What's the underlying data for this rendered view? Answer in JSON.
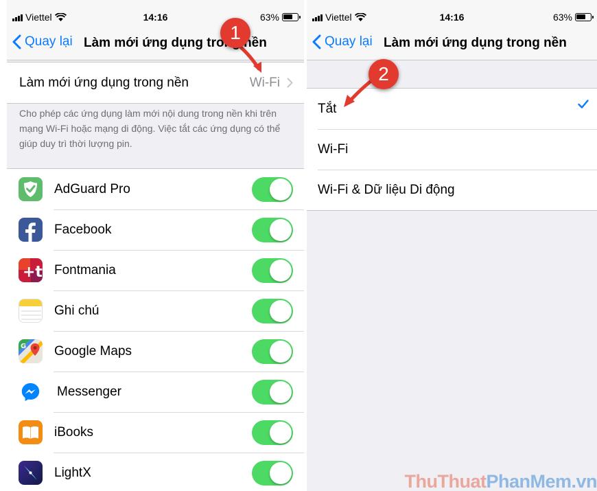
{
  "status": {
    "carrier": "Viettel",
    "time": "14:16",
    "battery": "63%"
  },
  "left": {
    "nav": {
      "back_label": "Quay lại",
      "title": "Làm mới ứng dụng trong nền"
    },
    "setting": {
      "label": "Làm mới ứng dụng trong nền",
      "value": "Wi-Fi"
    },
    "note": "Cho phép các ứng dụng làm mới nội dung trong nền khi trên mạng Wi-Fi hoặc mạng di động. Việc tắt các ứng dụng có thể giúp duy trì thời lượng pin.",
    "apps": [
      {
        "name": "AdGuard Pro",
        "icon": "adguard-icon",
        "enabled": true
      },
      {
        "name": "Facebook",
        "icon": "facebook-icon",
        "enabled": true
      },
      {
        "name": "Fontmania",
        "icon": "fontmania-icon",
        "enabled": true
      },
      {
        "name": "Ghi chú",
        "icon": "notes-icon",
        "enabled": true
      },
      {
        "name": "Google Maps",
        "icon": "google-maps-icon",
        "enabled": true
      },
      {
        "name": "Messenger",
        "icon": "messenger-icon",
        "enabled": true
      },
      {
        "name": "iBooks",
        "icon": "ibooks-icon",
        "enabled": true
      },
      {
        "name": "LightX",
        "icon": "lightx-icon",
        "enabled": true
      }
    ]
  },
  "right": {
    "nav": {
      "back_label": "Quay lại",
      "title": "Làm mới ứng dụng trong nền"
    },
    "options": [
      {
        "label": "Tắt",
        "selected": true
      },
      {
        "label": "Wi-Fi",
        "selected": false
      },
      {
        "label": "Wi-Fi & Dữ liệu Di động",
        "selected": false
      }
    ]
  },
  "annotations": {
    "marker1": "1",
    "marker2": "2"
  },
  "watermark": {
    "part1": "ThuThuat",
    "part2": "PhanMem",
    "part3": ".vn"
  },
  "colors": {
    "ios_blue": "#0a7afe",
    "toggle_green": "#4cd964",
    "marker_red": "#e23a2e",
    "group_bg": "#efeff4"
  }
}
